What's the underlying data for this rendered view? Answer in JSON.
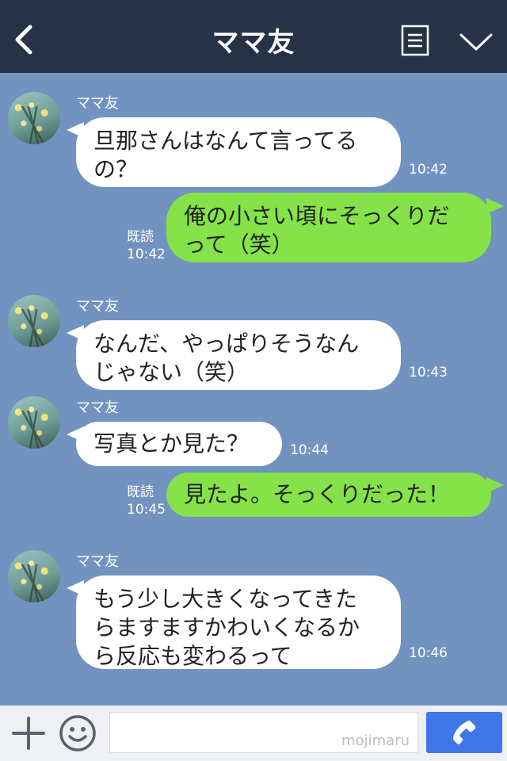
{
  "header": {
    "title": "ママ友"
  },
  "messages": [
    {
      "sender": "ママ友",
      "lines": [
        "旦那さんはなんて言ってる",
        "の？"
      ],
      "time": "10:42"
    },
    {
      "lines": [
        "俺の小さい頃にそっくりだ",
        "って（笑）"
      ],
      "read": "既読",
      "time": "10:42"
    },
    {
      "sender": "ママ友",
      "lines": [
        "なんだ、やっぱりそうなん",
        "じゃない（笑）"
      ],
      "time": "10:43"
    },
    {
      "sender": "ママ友",
      "lines": [
        "写真とか見た？"
      ],
      "time": "10:44"
    },
    {
      "lines": [
        "見たよ。そっくりだった！"
      ],
      "read": "既読",
      "time": "10:45"
    },
    {
      "sender": "ママ友",
      "lines": [
        "もう少し大きくなってきた",
        "らますますかわいくなるか",
        "ら反応も変わるって"
      ],
      "time": "10:46"
    }
  ],
  "footer": {
    "watermark": "mojimaru"
  },
  "icons": [
    "back-icon",
    "memo-icon",
    "chevron-down-icon",
    "plus-icon",
    "emoji-icon",
    "phone-icon"
  ],
  "colors": {
    "header": "#273246",
    "background": "#7293c0",
    "outgoing_bubble": "#85e249",
    "call_button": "#3f77e8"
  }
}
